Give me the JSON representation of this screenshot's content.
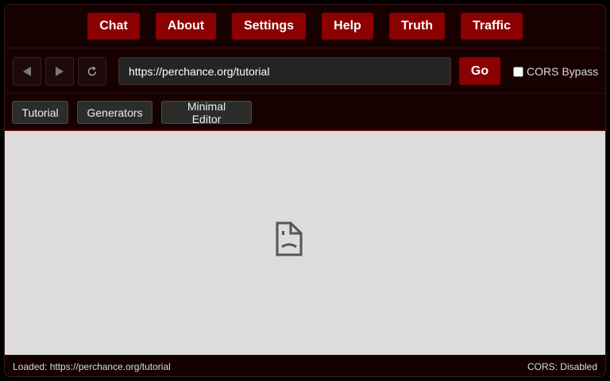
{
  "nav": {
    "items": [
      {
        "label": "Chat"
      },
      {
        "label": "About"
      },
      {
        "label": "Settings"
      },
      {
        "label": "Help"
      },
      {
        "label": "Truth"
      },
      {
        "label": "Traffic"
      }
    ]
  },
  "toolbar": {
    "back_icon": "triangle-left-icon",
    "forward_icon": "triangle-right-icon",
    "reload_icon": "reload-icon",
    "url_value": "https://perchance.org/tutorial",
    "go_label": "Go",
    "cors_label": "CORS Bypass",
    "cors_checked": false
  },
  "bookmarks": [
    {
      "label": "Tutorial"
    },
    {
      "label": "Generators"
    },
    {
      "label": "Minimal Editor"
    }
  ],
  "viewport": {
    "icon": "broken-page-icon"
  },
  "status": {
    "loaded": "Loaded: https://perchance.org/tutorial",
    "cors": "CORS: Disabled"
  },
  "colors": {
    "accent": "#8b0000",
    "background": "#160000",
    "viewport": "#dcdcdc"
  }
}
